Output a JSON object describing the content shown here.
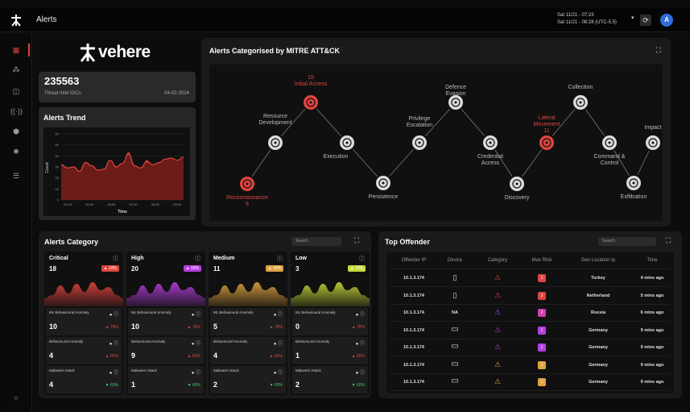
{
  "topbar": {
    "title": "Alerts",
    "datetime_line1": "Sat 11/21 - 07:23",
    "datetime_line2": "Sat 11/21 - 08:28 (UTC-5.5)",
    "dropdown_glyph": "▾",
    "refresh_glyph": "⟳",
    "avatar_initial": "A"
  },
  "colors": {
    "accent_red": "#e0443f",
    "critical": "#e0443f",
    "high": "#b53fe0",
    "medium": "#e0a43f",
    "low": "#c9d93a",
    "avatar": "#2f6bdc"
  },
  "brand": {
    "name": "vehere"
  },
  "stat": {
    "value": "235563",
    "label": "Threat Intel IOCs",
    "date": "04-02-2024"
  },
  "alerts_trend": {
    "title": "Alerts Trend",
    "ylabel": "Count",
    "xlabel": "Time",
    "yticks": [
      "60",
      "50",
      "40",
      "30",
      "20",
      "10",
      "0"
    ],
    "xticks": [
      "04:00",
      "05:00",
      "06:00",
      "07:00",
      "08:00",
      "09:00"
    ]
  },
  "chart_data": {
    "type": "area",
    "x": [
      0,
      1,
      2,
      3,
      4,
      5,
      6,
      7,
      8,
      9,
      10,
      11,
      12,
      13,
      14,
      15,
      16,
      17,
      18,
      19,
      20
    ],
    "values": [
      32,
      29,
      30,
      26,
      34,
      31,
      27,
      28,
      36,
      30,
      33,
      42,
      31,
      29,
      35,
      32,
      34,
      37,
      38,
      36,
      39
    ],
    "title": "Alerts Trend",
    "xlabel": "Time",
    "ylabel": "Count",
    "ylim": [
      0,
      60
    ],
    "grid": true
  },
  "mitre": {
    "title": "Alerts Categorised by MITRE ATT&CK",
    "tactics": [
      {
        "label": "Reconnaissance",
        "count": "9",
        "highlight": true
      },
      {
        "label": "Resource Development",
        "count": "",
        "highlight": false
      },
      {
        "label": "Initial Access",
        "count": "15",
        "highlight": true
      },
      {
        "label": "Execution",
        "count": "",
        "highlight": false
      },
      {
        "label": "Persistence",
        "count": "",
        "highlight": false
      },
      {
        "label": "Privilege Escalation",
        "count": "",
        "highlight": false
      },
      {
        "label": "Defence Evasion",
        "count": "",
        "highlight": false
      },
      {
        "label": "Credential Access",
        "count": "",
        "highlight": false
      },
      {
        "label": "Discovery",
        "count": "",
        "highlight": false
      },
      {
        "label": "Lateral Movement",
        "count": "11",
        "highlight": true
      },
      {
        "label": "Collection",
        "count": "",
        "highlight": false
      },
      {
        "label": "Command & Control",
        "count": "",
        "highlight": false
      },
      {
        "label": "Exfiltration",
        "count": "",
        "highlight": false
      },
      {
        "label": "Impact",
        "count": "",
        "highlight": false
      }
    ]
  },
  "alerts_category": {
    "title": "Alerts Category",
    "search_placeholder": "Search",
    "cards": [
      {
        "name": "Critical",
        "count": "18",
        "badge": "▲ 10%",
        "color": "#e0443f",
        "subs": [
          {
            "name": "ML Behavioural Anomaly",
            "value": "10",
            "pct": "▲ 78%",
            "up": true
          },
          {
            "name": "Behavioural Anomaly",
            "value": "4",
            "pct": "▲ 66%",
            "up": true
          },
          {
            "name": "Malware/ Attack",
            "value": "4",
            "pct": "▼ 60%",
            "up": false
          }
        ]
      },
      {
        "name": "High",
        "count": "20",
        "badge": "▲ 20%",
        "color": "#b53fe0",
        "subs": [
          {
            "name": "ML Behavioural Anomaly",
            "value": "10",
            "pct": "▲ 78%",
            "up": true
          },
          {
            "name": "Behavioural Anomaly",
            "value": "9",
            "pct": "▲ 60%",
            "up": true
          },
          {
            "name": "Malware/ Attack",
            "value": "1",
            "pct": "▼ 60%",
            "up": false
          }
        ]
      },
      {
        "name": "Medium",
        "count": "11",
        "badge": "▲ 10%",
        "color": "#e0a43f",
        "subs": [
          {
            "name": "ML Behavioural Anomaly",
            "value": "5",
            "pct": "▲ 78%",
            "up": true
          },
          {
            "name": "Behavioural Anomaly",
            "value": "4",
            "pct": "▲ 66%",
            "up": true
          },
          {
            "name": "Malware/ Attack",
            "value": "2",
            "pct": "▼ 60%",
            "up": false
          }
        ]
      },
      {
        "name": "Low",
        "count": "3",
        "badge": "▲ 10%",
        "color": "#c9d93a",
        "subs": [
          {
            "name": "ML Behavioural Anomaly",
            "value": "0",
            "pct": "▲ 78%",
            "up": true
          },
          {
            "name": "Behavioural Anomaly",
            "value": "1",
            "pct": "▲ 66%",
            "up": true
          },
          {
            "name": "Malware/ Attack",
            "value": "2",
            "pct": "▼ 60%",
            "up": false
          }
        ]
      }
    ]
  },
  "top_offender": {
    "title": "Top Offender",
    "search_placeholder": "Search",
    "columns": [
      "Offender IP",
      "Device",
      "Category",
      "Max Risk",
      "Geo Location Ip",
      "Time"
    ],
    "rows": [
      {
        "ip": "10.1.3.174",
        "device": "mobile",
        "category_color": "#e0443f",
        "risk": "2",
        "risk_color": "#e0443f",
        "geo": "Turkey",
        "time": "4 mins ago"
      },
      {
        "ip": "10.1.3.174",
        "device": "mobile",
        "category_color": "#e0443f",
        "risk": "2",
        "risk_color": "#e0443f",
        "geo": "Netherland",
        "time": "5 mins ago"
      },
      {
        "ip": "10.1.3.174",
        "device": "NA",
        "category_color": "#b53fe0",
        "risk": "2",
        "risk_color": "#d23fa8",
        "geo": "Russia",
        "time": "6 mins ago"
      },
      {
        "ip": "10.1.3.174",
        "device": "laptop",
        "category_color": "#b53fe0",
        "risk": "1",
        "risk_color": "#b53fe0",
        "geo": "Germany",
        "time": "9 mins ago"
      },
      {
        "ip": "10.1.3.174",
        "device": "laptop",
        "category_color": "#b53fe0",
        "risk": "1",
        "risk_color": "#b53fe0",
        "geo": "Germany",
        "time": "9 mins ago"
      },
      {
        "ip": "10.1.3.174",
        "device": "laptop",
        "category_color": "#e0a43f",
        "risk": "1",
        "risk_color": "#e0a43f",
        "geo": "Germany",
        "time": "9 mins ago"
      },
      {
        "ip": "10.1.3.174",
        "device": "laptop",
        "category_color": "#e0a43f",
        "risk": "1",
        "risk_color": "#e0a43f",
        "geo": "Germany",
        "time": "9 mins ago"
      }
    ]
  },
  "icons": {
    "sidebar": [
      "dashboard-icon",
      "network-icon",
      "alerts-icon",
      "signal-icon",
      "shield-icon",
      "settings-gear-icon",
      "report-icon",
      "sun-icon"
    ],
    "expand": "expand-icon",
    "info": "info-icon"
  }
}
